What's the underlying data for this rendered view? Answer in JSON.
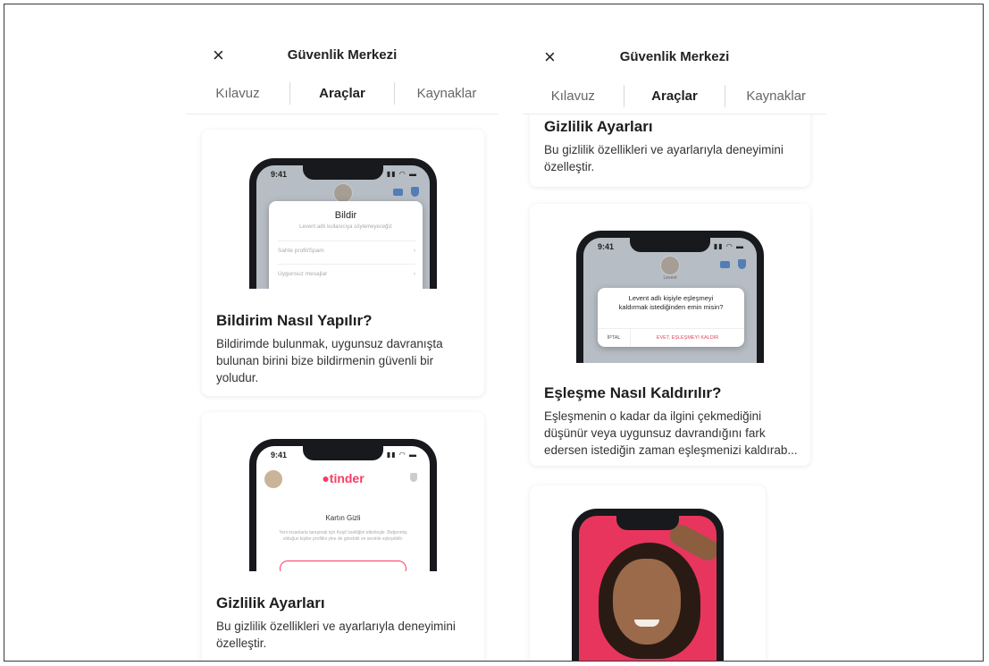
{
  "left": {
    "title": "Güvenlik Merkezi",
    "close_icon": "×",
    "tabs": [
      "Kılavuz",
      "Araçlar",
      "Kaynaklar"
    ],
    "cards": [
      {
        "phone": {
          "time": "9:41",
          "modal_title": "Bildir",
          "modal_subtitle": "Levent adlı kullanıcıya söylemeyeceğiz",
          "options": [
            "Sahte profil/Spam",
            "Uygunsuz mesajlar"
          ]
        },
        "title": "Bildirim Nasıl Yapılır?",
        "body": "Bildirimde bulunmak, uygunsuz davranışta bulunan birini bize bildirmenin güvenli bir yoludur."
      },
      {
        "phone": {
          "time": "9:41",
          "brand": "tinder",
          "heading": "Kartın Gizli",
          "text": "Yeni insanlarla tanışmak için Keşif özelliğini etkinleştir. Beğenmiş olduğun kişiler profilini yine de görebilir ve seninle eşleşebilir."
        },
        "title": "Gizlilik Ayarları",
        "body": "Bu gizlilik özellikleri ve ayarlarıyla deneyimini özelleştir."
      }
    ]
  },
  "right": {
    "title": "Güvenlik Merkezi",
    "close_icon": "×",
    "tabs": [
      "Kılavuz",
      "Araçlar",
      "Kaynaklar"
    ],
    "cards": [
      {
        "title": "Gizlilik Ayarları",
        "body": "Bu gizlilik özellikleri ve ayarlarıyla deneyimini özelleştir."
      },
      {
        "phone": {
          "time": "9:41",
          "name": "Levent",
          "modal_text": "Levent adlı kişiyle eşleşmeyi kaldırmak istediğinden emin misin?",
          "cancel": "İPTAL",
          "confirm": "EVET, EŞLEŞMEYİ KALDIR"
        },
        "title": "Eşleşme Nasıl Kaldırılır?",
        "body": "Eşleşmenin o kadar da ilgini çekmediğini düşünür veya uygunsuz davrandığını fark edersen istediğin zaman eşleşmenizi kaldırab..."
      }
    ]
  },
  "colors": {
    "accent": "#fd3a62",
    "modal_red": "#e0495a",
    "photo_bg": "#e8355d"
  }
}
